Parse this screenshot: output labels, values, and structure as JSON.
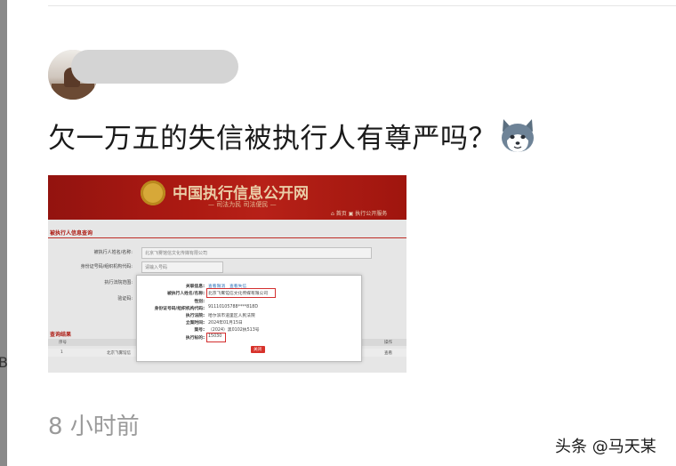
{
  "left_rail": {
    "glyph": "B"
  },
  "post": {
    "title": "欠一万五的失信被执行人有尊严吗？",
    "emoji_icon": "husky-emoji",
    "timestamp": "8 小时前"
  },
  "screenshot": {
    "site_title": "中国执行信息公开网",
    "site_motto": "— 司法为民 司法便民 —",
    "nav_links": "⌂ 首页  ▣ 执行公开服务",
    "section_title": "被执行人信息查询",
    "form": [
      {
        "label": "被执行人姓名/名称:",
        "value": "北京飞雾馆信文化传媒有限公司"
      },
      {
        "label": "身份证号码/组织机构代码:",
        "value": "请输入号码"
      },
      {
        "label": "执行法院范围:",
        "value": ""
      },
      {
        "label": "验证码:",
        "value": ""
      }
    ],
    "results_title": "查询结果",
    "results_headers": [
      "序号",
      "操作"
    ],
    "results_row": [
      "1",
      "北京飞雾馆信",
      "查看"
    ],
    "modal": {
      "top_links": [
        "查看限消",
        "查看失信"
      ],
      "rows": [
        {
          "label": "关联信息:",
          "value": ""
        },
        {
          "label": "被执行人姓名/名称:",
          "value": "北京飞雾馆信文化传媒有限公司"
        },
        {
          "label": "性别:",
          "value": ""
        },
        {
          "label": "身份证号码/组织机构代码:",
          "value": "91110105788****818D"
        },
        {
          "label": "执行法院:",
          "value": "哈尔滨市道里区人民法院"
        },
        {
          "label": "立案时间:",
          "value": "2024年01月15日"
        },
        {
          "label": "案号:",
          "value": "（2024）黑0102执513号"
        },
        {
          "label": "执行标的:",
          "value": "15030"
        }
      ],
      "close_label": "关闭"
    }
  },
  "watermark": "头条 @马天某"
}
